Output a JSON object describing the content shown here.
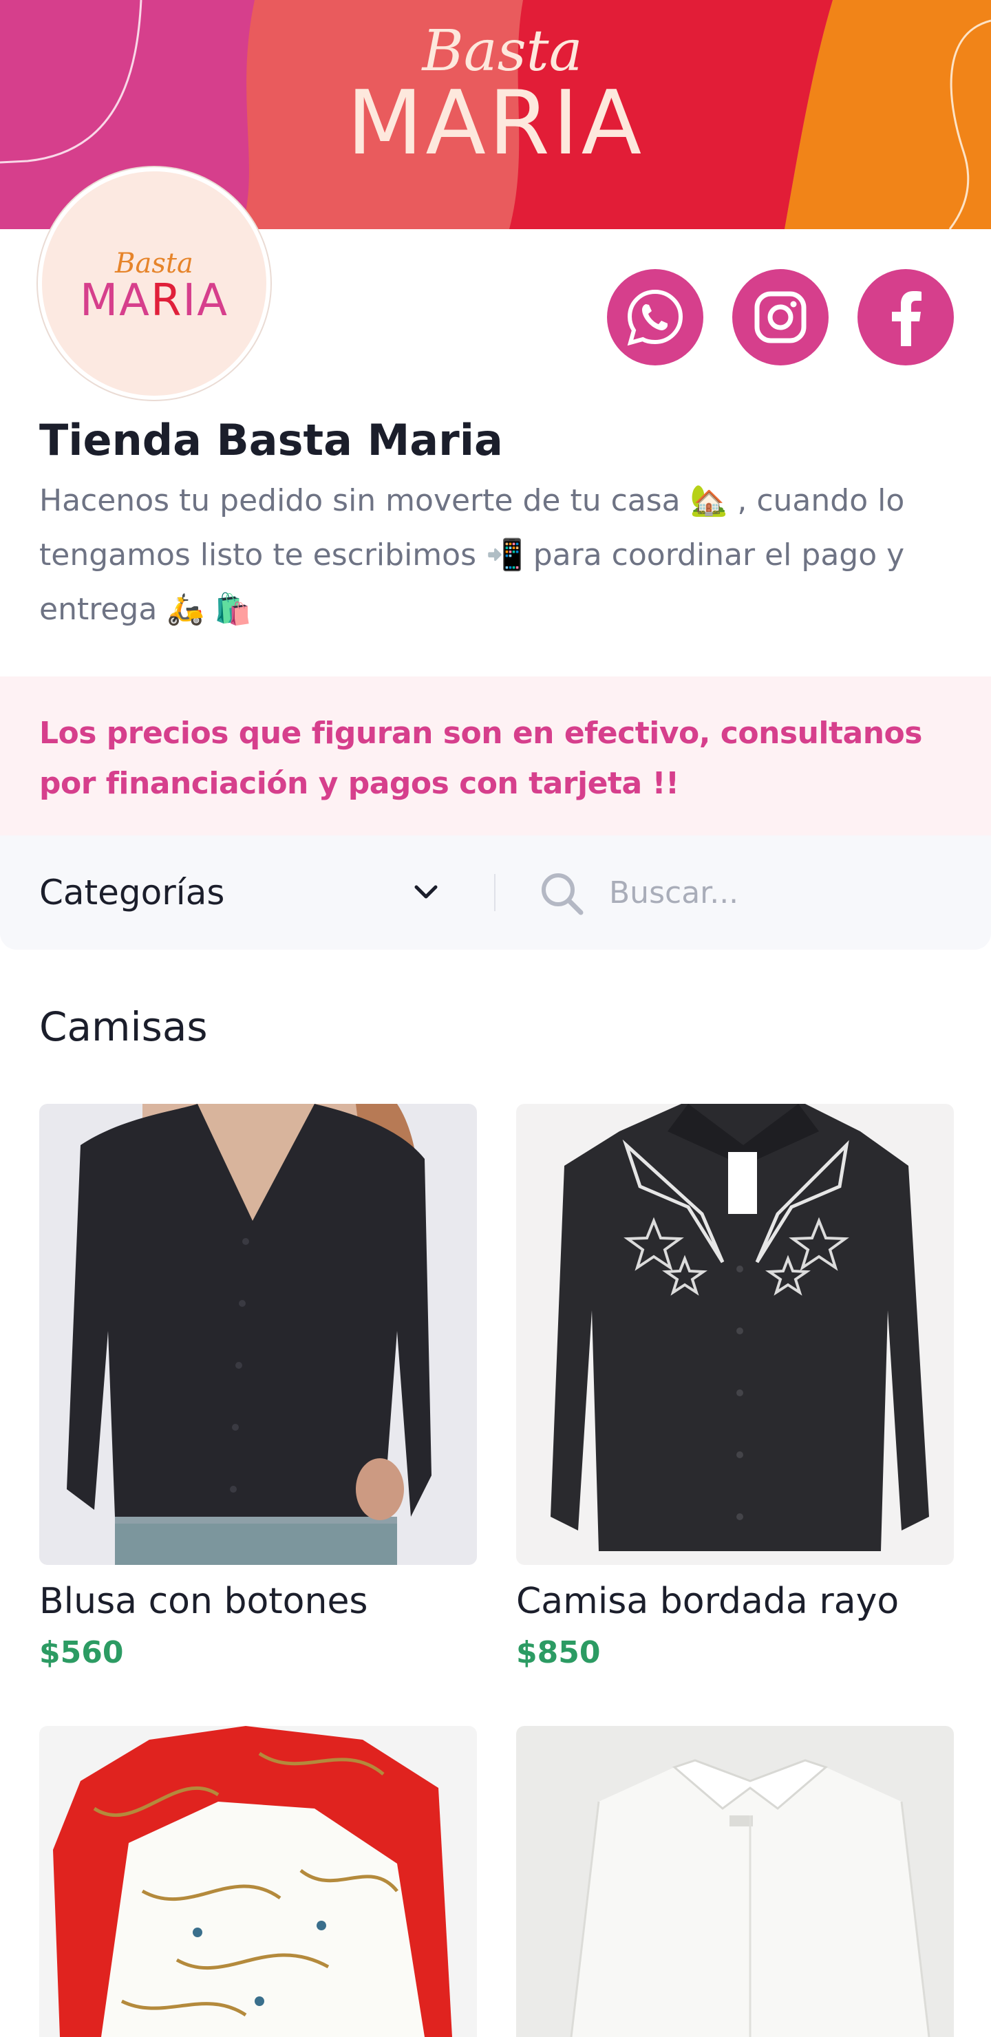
{
  "banner": {
    "logo_script": "Basta",
    "logo_caps": "MARIA",
    "colors": [
      "#d63f8c",
      "#e85a5a",
      "#e0203a",
      "#f0861e"
    ]
  },
  "avatar": {
    "logo_script": "Basta",
    "logo_caps_a": "MA",
    "logo_caps_r": "R",
    "logo_caps_b": "IA"
  },
  "social": {
    "whatsapp": "whatsapp-icon",
    "instagram": "instagram-icon",
    "facebook": "facebook-icon",
    "color": "#d63f8c"
  },
  "store": {
    "title": "Tienda Basta Maria",
    "description": "Hacenos tu pedido sin moverte de tu casa 🏡 , cuando lo tengamos listo te escribimos 📲 para coordinar el pago y entrega 🛵 🛍️"
  },
  "notice": {
    "text": "Los precios que figuran son en efectivo, consultanos por financiación y pagos con tarjeta !!"
  },
  "filters": {
    "category_label": "Categorías",
    "search_placeholder": "Buscar..."
  },
  "section": {
    "title": "Camisas"
  },
  "products": [
    {
      "name": "Blusa con botones",
      "price": "$560"
    },
    {
      "name": "Camisa bordada rayo",
      "price": "$850"
    },
    {
      "name": "",
      "price": ""
    },
    {
      "name": "",
      "price": ""
    }
  ],
  "price_color": "#2c9b63"
}
